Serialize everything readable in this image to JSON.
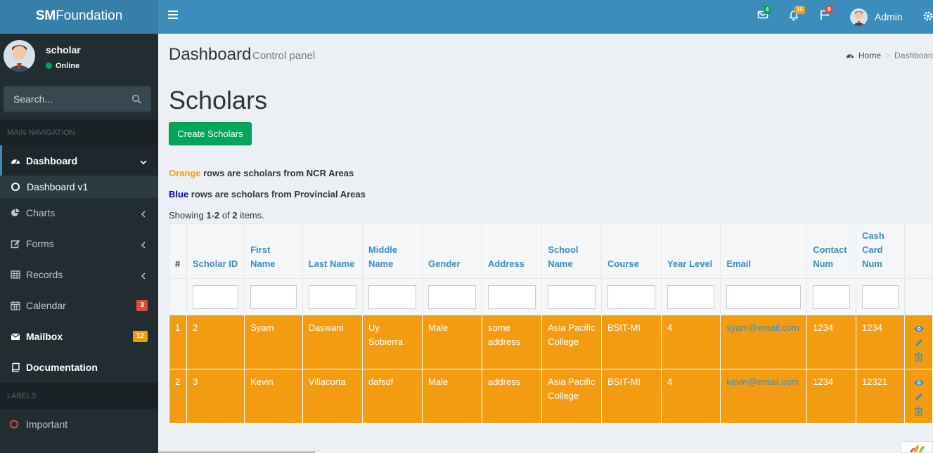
{
  "brand": {
    "bold": "SM",
    "rest": "Foundation"
  },
  "topbar": {
    "messages_count": "4",
    "notifications_count": "10",
    "tasks_count": "9",
    "user_name": "Admin"
  },
  "sidebar": {
    "user": {
      "name": "scholar",
      "status": "Online"
    },
    "search_placeholder": "Search...",
    "main_nav_header": "MAIN NAVIGATION",
    "items": [
      {
        "label": "Dashboard",
        "icon": "dashboard-icon"
      },
      {
        "label": "Charts",
        "icon": "pie-chart-icon"
      },
      {
        "label": "Forms",
        "icon": "edit-icon"
      },
      {
        "label": "Records",
        "icon": "table-icon"
      },
      {
        "label": "Calendar",
        "icon": "calendar-icon",
        "badge": "3"
      },
      {
        "label": "Mailbox",
        "icon": "envelope-icon",
        "badge": "12"
      },
      {
        "label": "Documentation",
        "icon": "book-icon"
      }
    ],
    "submenu_item": "Dashboard v1",
    "labels_header": "LABELS",
    "label_items": [
      {
        "label": "Important",
        "color": "#dd4b39"
      }
    ]
  },
  "content": {
    "title": "Dashboard",
    "subtitle": "Control panel",
    "breadcrumb": {
      "home": "Home",
      "current": "Dashboard"
    },
    "heading": "Scholars",
    "create_button": "Create Scholars",
    "legend": {
      "orange_word": "Orange",
      "orange_rest": " rows are scholars from NCR Areas",
      "blue_word": "Blue",
      "blue_rest": " rows are scholars from Provincial Areas"
    },
    "summary": {
      "prefix": "Showing ",
      "range": "1-2",
      "of": " of ",
      "total": "2",
      "suffix": " items."
    },
    "table": {
      "headers": [
        "#",
        "Scholar ID",
        "First Name",
        "Last Name",
        "Middle Name",
        "Gender",
        "Address",
        "School Name",
        "Course",
        "Year Level",
        "Email",
        "Contact Num",
        "Cash Card Num"
      ],
      "rows": [
        {
          "num": "1",
          "scholar_id": "2",
          "first": "Syam",
          "last": "Daswani",
          "middle": "Uy Sobierra",
          "gender": "Male",
          "address": "some address",
          "school": "Asia Pacific College",
          "course": "BSIT-MI",
          "year": "4",
          "email": "syam@email.com",
          "contact": "1234",
          "cash": "1234",
          "row_color": "#f39c12"
        },
        {
          "num": "2",
          "scholar_id": "3",
          "first": "Kevin",
          "last": "Villacorta",
          "middle": "dafsdf",
          "gender": "Male",
          "address": "address",
          "school": "Asia Pacific College",
          "course": "BSIT-MI",
          "year": "4",
          "email": "kevin@email.com",
          "contact": "1234",
          "cash": "12321",
          "row_color": "#f39c12"
        }
      ]
    }
  },
  "colors": {
    "primary": "#3c8dbc",
    "success": "#00a65a",
    "warning": "#f39c12",
    "danger": "#dd4b39",
    "sidebar_bg": "#222d32"
  }
}
